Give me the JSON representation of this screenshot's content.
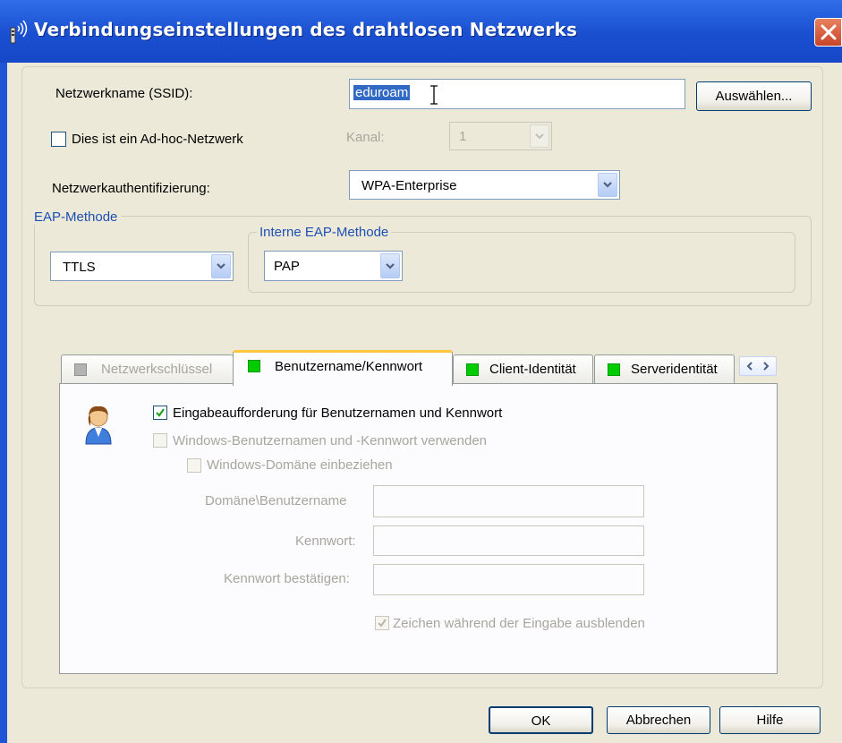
{
  "window": {
    "title": "Verbindungseinstellungen des drahtlosen Netzwerks"
  },
  "ssid": {
    "label": "Netzwerkname (SSID):",
    "value": "eduroam",
    "choose_button": "Auswählen..."
  },
  "adhoc": {
    "label": "Dies ist ein Ad-hoc-Netzwerk",
    "checked": false
  },
  "channel": {
    "label": "Kanal:",
    "value": "1"
  },
  "auth": {
    "label": "Netzwerkauthentifizierung:",
    "value": "WPA-Enterprise"
  },
  "eap": {
    "group_label": "EAP-Methode",
    "value": "TTLS",
    "inner_group_label": "Interne EAP-Methode",
    "inner_value": "PAP"
  },
  "tabs": [
    {
      "label": "Netzwerkschlüssel",
      "enabled": false
    },
    {
      "label": "Benutzername/Kennwort",
      "enabled": true,
      "active": true
    },
    {
      "label": "Client-Identität",
      "enabled": true
    },
    {
      "label": "Serveridentität",
      "enabled": true
    }
  ],
  "credentials": {
    "prompt_label": "Eingabeaufforderung für Benutzernamen und Kennwort",
    "prompt_checked": true,
    "windows_creds_label": "Windows-Benutzernamen und -Kennwort verwenden",
    "windows_domain_label": "Windows-Domäne einbeziehen",
    "domain_user_label": "Domäne\\Benutzername",
    "password_label": "Kennwort:",
    "confirm_label": "Kennwort bestätigen:",
    "hide_chars_label": "Zeichen während der Eingabe ausblenden"
  },
  "buttons": {
    "ok": "OK",
    "cancel": "Abbrechen",
    "help": "Hilfe"
  },
  "colors": {
    "titlebar": "#1A4FD0",
    "dialog_bg": "#ECE9D8",
    "tab_indicator_green": "#00CC00",
    "tab_active_highlight": "#FFC83C",
    "group_label": "#1E4FB5",
    "close_button": "#D65C3C"
  }
}
